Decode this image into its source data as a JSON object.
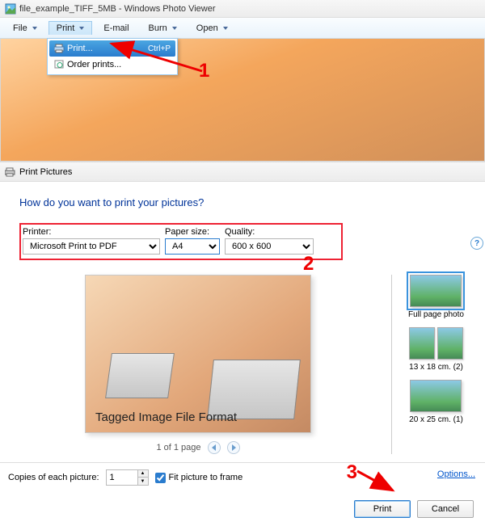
{
  "window": {
    "title": "file_example_TIFF_5MB - Windows Photo Viewer"
  },
  "menubar": {
    "file": "File",
    "print": "Print",
    "email": "E-mail",
    "burn": "Burn",
    "open": "Open"
  },
  "dropdown": {
    "print": "Print...",
    "print_shortcut": "Ctrl+P",
    "order_prints": "Order prints..."
  },
  "dialog": {
    "title": "Print Pictures",
    "question": "How do you want to print your pictures?",
    "printer_label": "Printer:",
    "printer_value": "Microsoft Print to PDF",
    "paper_label": "Paper size:",
    "paper_value": "A4",
    "quality_label": "Quality:",
    "quality_value": "600 x 600",
    "preview_caption": "Tagged Image File Format",
    "pager": "1 of 1 page",
    "layouts": {
      "full": "Full page photo",
      "l13": "13 x 18 cm. (2)",
      "l20": "20 x 25 cm. (1)"
    },
    "copies_label": "Copies of each picture:",
    "copies_value": "1",
    "fit_label": "Fit picture to frame",
    "options": "Options...",
    "print_btn": "Print",
    "cancel_btn": "Cancel"
  },
  "annotations": {
    "a1": "1",
    "a2": "2",
    "a3": "3"
  }
}
